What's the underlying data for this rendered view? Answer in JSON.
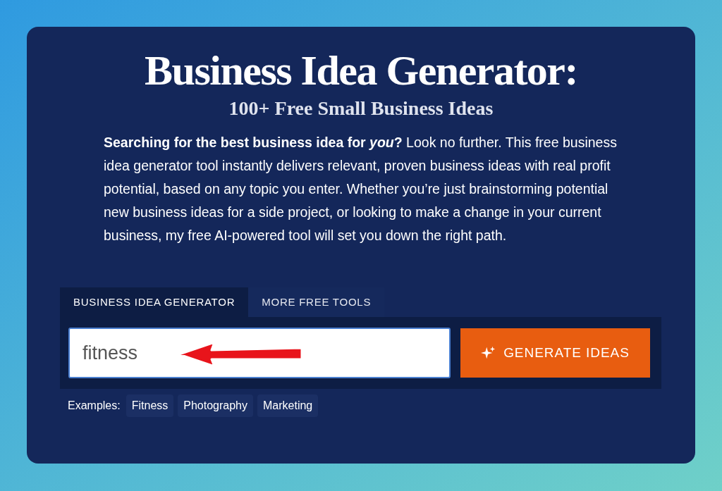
{
  "title": "Business Idea Generator:",
  "subtitle": "100+ Free Small Business Ideas",
  "intro": "**Searching for the best business idea for *you*?** Look no further. This free business idea generator tool instantly delivers relevant, proven business ideas with real profit potential, based on any topic you enter. Whether you’re just brainstorming potential new business ideas for a side project, or looking to make a change in your current business, my free AI-powered tool will set you down the right path.",
  "tabs": [
    {
      "label": "BUSINESS IDEA GENERATOR",
      "selected": true
    },
    {
      "label": "MORE FREE TOOLS",
      "selected": false
    }
  ],
  "topic_field": {
    "value": "fitness"
  },
  "generate_button": "GENERATE IDEAS",
  "examples": {
    "label": "Examples:",
    "items": [
      "Fitness",
      "Photography",
      "Marketing"
    ]
  }
}
